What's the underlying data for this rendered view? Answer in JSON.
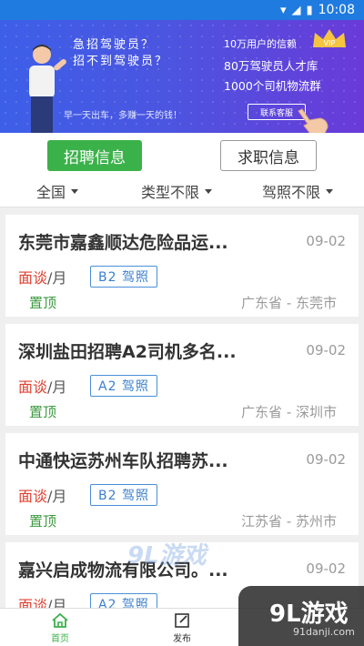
{
  "status_bar": {
    "time": "10:08",
    "icons": [
      "wifi-icon",
      "signal-icon",
      "battery-icon"
    ]
  },
  "banner": {
    "question1": "急招驾驶员？",
    "question2": "招不到驾驶员？",
    "slogan": "早一天出车，多赚一天的钱！",
    "line1": "10万用户的信赖",
    "line2": "80万驾驶员人才库",
    "line3": "1000个司机物流群",
    "vip": "VIP",
    "contact_button": "联系客服"
  },
  "tabs": [
    {
      "label": "招聘信息",
      "active": true
    },
    {
      "label": "求职信息",
      "active": false
    }
  ],
  "filters": [
    {
      "label": "全国"
    },
    {
      "label": "类型不限"
    },
    {
      "label": "驾照不限"
    }
  ],
  "jobs": [
    {
      "title": "东莞市嘉鑫顺达危险品运...",
      "date": "09-02",
      "salary_neg": "面谈",
      "salary_unit": "/月",
      "license": "B2 驾照",
      "pin": "置顶",
      "location": "广东省 - 东莞市"
    },
    {
      "title": "深圳盐田招聘A2司机多名...",
      "date": "09-02",
      "salary_neg": "面谈",
      "salary_unit": "/月",
      "license": "A2 驾照",
      "pin": "置顶",
      "location": "广东省 - 深圳市"
    },
    {
      "title": "中通快运苏州车队招聘苏...",
      "date": "09-02",
      "salary_neg": "面谈",
      "salary_unit": "/月",
      "license": "B2 驾照",
      "pin": "置顶",
      "location": "江苏省 - 苏州市"
    },
    {
      "title": "嘉兴启成物流有限公司。...",
      "date": "09-02",
      "salary_neg": "面谈",
      "salary_unit": "/月",
      "license": "A2 驾照",
      "pin": "",
      "location": ""
    }
  ],
  "watermark": {
    "mid": "9L游戏",
    "corner": "9L游戏",
    "corner_url": "91danji.com"
  },
  "bottom_nav": [
    {
      "label": "首页",
      "icon": "home-icon",
      "active": true
    },
    {
      "label": "发布",
      "icon": "edit-icon",
      "active": false
    }
  ],
  "colors": {
    "accent_green": "#3bb14a",
    "banner_blue": "#3d5fe8",
    "price_red": "#e04030",
    "license_blue": "#3a7fd0"
  }
}
